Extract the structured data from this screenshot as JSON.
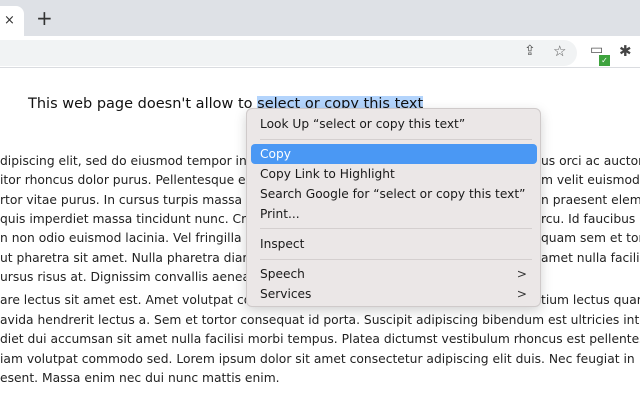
{
  "browser": {
    "close_tab": "×",
    "new_tab": "+",
    "icons": [
      "share-icon",
      "star-icon",
      "extension-status-icon",
      "puzzle-icon"
    ],
    "badge_color": "#3ea33e"
  },
  "page": {
    "heading_before": "This web page doesn't allow to ",
    "heading_selected": "select or copy this text",
    "para1_left": [
      "dipiscing elit, sed do eiusmod tempor inci",
      "itor rhoncus dolor purus. Pellentesque eu",
      "rtor vitae purus. In cursus turpis massa tir",
      "quis imperdiet massa tincidunt nunc. Cras",
      "n non odio euismod lacinia. Vel fringilla est",
      "ut pharetra sit amet. Nulla pharetra diam",
      "ursus risus at. Dignissim convallis aenean"
    ],
    "para1_right": [
      "us orci ac auctor.",
      "m velit euismod",
      "n praesent eleme",
      "rcu. Id faucibus n",
      "quam sem et tort",
      "amet nulla facilis",
      ""
    ],
    "para2_left": [
      "are lectus sit amet est. Amet volutpat cons",
      "avida hendrerit lectus a. Sem et tortor consequat id porta. Suscipit adipiscing bibendum est ultricies integer q",
      "diet dui accumsan sit amet nulla facilisi morbi tempus. Platea dictumst vestibulum rhoncus est pellentesque",
      "iam volutpat commodo sed. Lorem ipsum dolor sit amet consectetur adipiscing elit duis. Nec feugiat in",
      "esent. Massa enim nec dui nunc mattis enim."
    ],
    "para2_right": [
      "tium lectus quam",
      "",
      "",
      "",
      ""
    ]
  },
  "context_menu": {
    "items": [
      {
        "label": "Look Up “select or copy this text”"
      },
      {
        "label": "Copy",
        "highlighted": true
      },
      {
        "label": "Copy Link to Highlight"
      },
      {
        "label": "Search Google for “select or copy this text”"
      },
      {
        "label": "Print..."
      },
      {
        "label": "Inspect"
      },
      {
        "label": "Speech",
        "submenu": true,
        "chevron": ">"
      },
      {
        "label": "Services",
        "submenu": true,
        "chevron": ">"
      }
    ],
    "highlight_color": "#4a98f4"
  }
}
